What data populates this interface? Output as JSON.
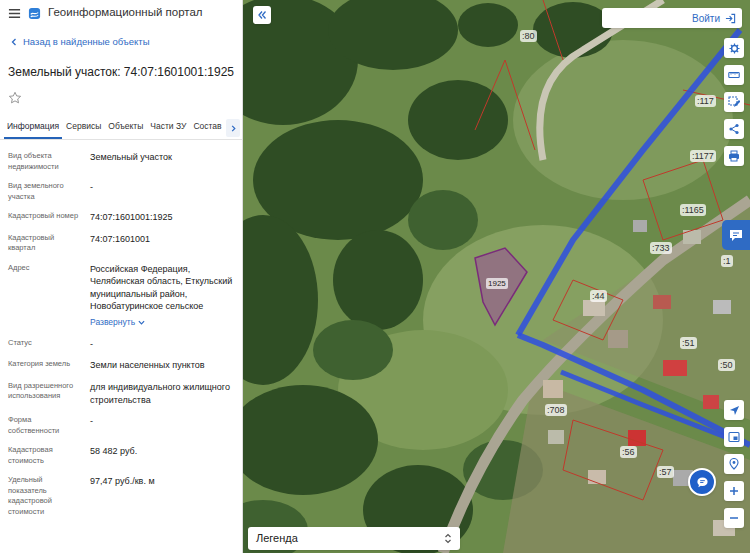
{
  "header": {
    "title": "Геоинформационный портал"
  },
  "back_link": "Назад в найденные объекты",
  "object": {
    "title": "Земельный участок: 74:07:1601001:1925",
    "favorite": false
  },
  "tabs": [
    {
      "label": "Информация",
      "selected": true
    },
    {
      "label": "Сервисы",
      "selected": false
    },
    {
      "label": "Объекты",
      "selected": false
    },
    {
      "label": "Части ЗУ",
      "selected": false
    },
    {
      "label": "Состав",
      "selected": false
    }
  ],
  "fields": [
    {
      "label": "Вид объекта недвижимости",
      "value": "Земельный участок"
    },
    {
      "label": "Вид земельного участка",
      "value": "-"
    },
    {
      "label": "Кадастровый номер",
      "value": "74:07:1601001:1925"
    },
    {
      "label": "Кадастровый квартал",
      "value": "74:07:1601001"
    },
    {
      "label": "Адрес",
      "value": "Российская Федерация, Челябинская область, Еткульский муниципальный район, Новобатуринское сельское",
      "link": "Развернуть"
    },
    {
      "label": "Статус",
      "value": "-"
    },
    {
      "label": "Категория земель",
      "value": "Земли населенных пунктов"
    },
    {
      "label": "Вид разрешенного использования",
      "value": "для индивидуального жилищного строительства"
    },
    {
      "label": "Форма собственности",
      "value": "-"
    },
    {
      "label": "Кадастровая стоимость",
      "value": "58 482 руб."
    },
    {
      "label": "Удельный показатель кадастровой стоимости",
      "value": "97,47 руб./кв. м"
    }
  ],
  "map": {
    "login": "Войти",
    "legend": "Легенда",
    "parcel": {
      "label": "1925",
      "selected": true
    },
    "labels": [
      {
        "text": ":80"
      },
      {
        "text": ":117"
      },
      {
        "text": ":1177"
      },
      {
        "text": ":1165"
      },
      {
        "text": ":733"
      },
      {
        "text": ":1"
      },
      {
        "text": ":44"
      },
      {
        "text": ":51"
      },
      {
        "text": ":50"
      },
      {
        "text": ":708"
      },
      {
        "text": ":56"
      },
      {
        "text": ":57"
      }
    ]
  }
}
